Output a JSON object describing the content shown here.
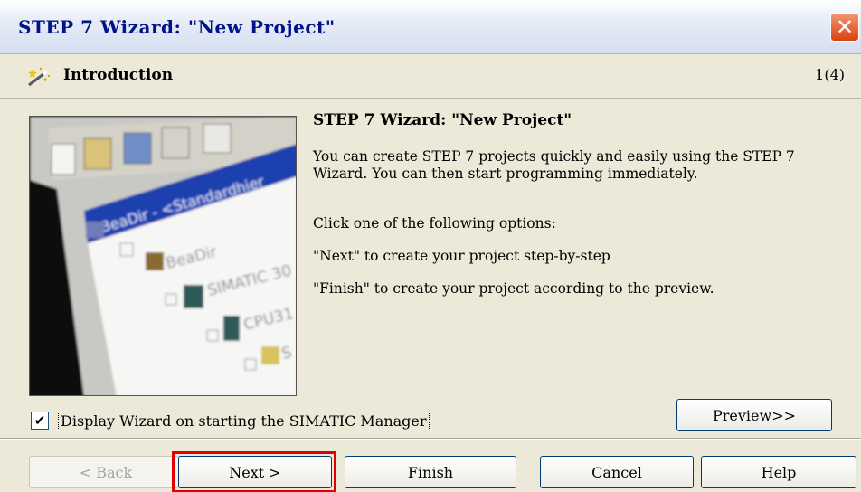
{
  "window": {
    "title": "STEP 7 Wizard: \"New Project\"",
    "close_glyph": "✕"
  },
  "header": {
    "icon": "magic-wand-icon",
    "title": "Introduction",
    "step": "1(4)"
  },
  "preview_image": {
    "toolbar_text": "BeaDir - <Standardhier",
    "tree_root": "BeaDir",
    "tree_items": [
      "SIMATIC 30",
      "CPU31",
      "S"
    ]
  },
  "content": {
    "title": "STEP 7 Wizard: \"New Project\"",
    "description": "You can create STEP 7 projects quickly and easily using the STEP 7 Wizard. You can then start programming immediately.",
    "prompt": "Click one of the following options:",
    "option_next": "\"Next\" to create your project step-by-step",
    "option_finish": "\"Finish\" to create your project according to the preview."
  },
  "options": {
    "display_wizard_label": "Display Wizard on starting the SIMATIC Manager",
    "display_wizard_checked": true,
    "checkmark": "✔"
  },
  "buttons": {
    "preview": "Preview>>",
    "back": "< Back",
    "next": "Next >",
    "finish": "Finish",
    "cancel": "Cancel",
    "help": "Help"
  },
  "colors": {
    "title_text": "#00138a",
    "close_button": "#d8430e",
    "highlight": "#e00000"
  }
}
